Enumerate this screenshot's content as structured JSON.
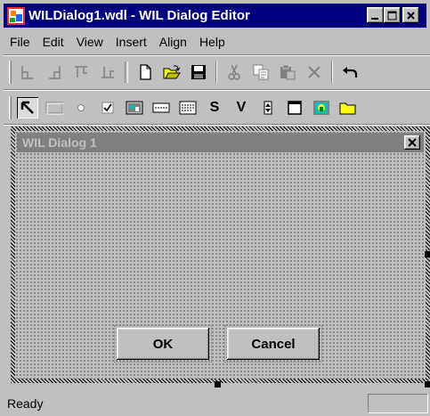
{
  "window": {
    "title": "WILDialog1.wdl - WIL Dialog Editor",
    "controls": {
      "minimize_icon": "minimize-icon",
      "maximize_icon": "maximize-icon",
      "close_icon": "close-icon"
    }
  },
  "menu": {
    "items": [
      {
        "label": "File"
      },
      {
        "label": "Edit"
      },
      {
        "label": "View"
      },
      {
        "label": "Insert"
      },
      {
        "label": "Align"
      },
      {
        "label": "Help"
      }
    ]
  },
  "toolbar1": {
    "buttons": [
      "align-left-icon",
      "align-right-icon",
      "align-top-icon",
      "align-bottom-icon",
      "new-file-icon",
      "open-folder-icon",
      "save-icon",
      "cut-icon",
      "copy-icon",
      "paste-icon",
      "delete-icon",
      "undo-icon"
    ]
  },
  "toolbar2": {
    "buttons": [
      "select-arrow-icon",
      "groupbox-icon",
      "radio-button-icon",
      "checkbox-icon",
      "picture-icon",
      "edit-box-icon",
      "multi-line-edit-icon",
      "static-text-icon",
      "variable-text-icon",
      "spinner-icon",
      "frame-icon",
      "picture-button-icon",
      "folder-icon"
    ],
    "static_glyph": "S",
    "variable_glyph": "V"
  },
  "dialog": {
    "title": "WIL Dialog 1",
    "ok_label": "OK",
    "cancel_label": "Cancel"
  },
  "status": {
    "text": "Ready"
  },
  "colors": {
    "title_active": "#000080",
    "title_inactive": "#808080",
    "face": "#c0c0c0"
  }
}
